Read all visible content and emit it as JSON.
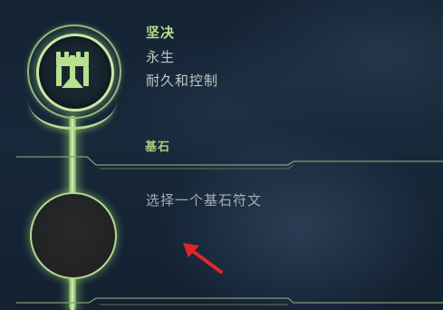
{
  "tree": {
    "name": "坚决",
    "subtitle": "永生",
    "description": "耐久和控制",
    "emblem_icon": "fortress-icon",
    "accent_color": "#b8de8e"
  },
  "keystone": {
    "section_label": "基石",
    "prompt": "选择一个基石符文",
    "slot_icon": "empty-slot"
  },
  "annotation": {
    "pointer_icon": "red-arrow-icon",
    "color": "#e0262b"
  }
}
